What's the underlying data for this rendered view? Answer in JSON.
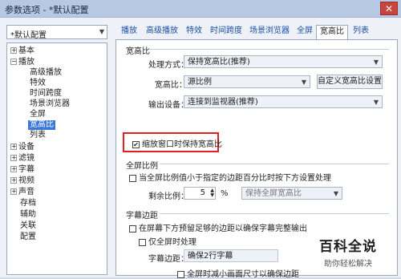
{
  "window": {
    "title": "参数选项 - *默认配置",
    "close_glyph": "✕"
  },
  "profile": {
    "value": "*默认配置"
  },
  "tree": [
    {
      "label": "基本",
      "expander": "+"
    },
    {
      "label": "播放",
      "expander": "−"
    },
    {
      "label": "高级播放"
    },
    {
      "label": "特效"
    },
    {
      "label": "时间跨度"
    },
    {
      "label": "场景浏览器"
    },
    {
      "label": "全屏"
    },
    {
      "label": "宽高比",
      "selected": true
    },
    {
      "label": "列表"
    },
    {
      "label": "设备",
      "expander": "+"
    },
    {
      "label": "滤镜",
      "expander": "+"
    },
    {
      "label": "字幕",
      "expander": "+"
    },
    {
      "label": "视频",
      "expander": "+"
    },
    {
      "label": "声音",
      "expander": "+"
    },
    {
      "label": "存档"
    },
    {
      "label": "辅助"
    },
    {
      "label": "关联"
    },
    {
      "label": "配置"
    }
  ],
  "tabs": [
    "播放",
    "高级播放",
    "特效",
    "时间跨度",
    "场景浏览器",
    "全屏",
    "宽高比",
    "列表"
  ],
  "aspect_group": {
    "title": "宽高比",
    "method_label": "处理方式：",
    "method_value": "保持宽高比(推荐)",
    "ratio_label": "宽高比：",
    "ratio_value": "源比例",
    "custom_button": "自定义宽高比设置",
    "output_label": "输出设备：",
    "output_value": "连接到监视器(推荐)",
    "keep_ratio_check": "缩放窗口时保持宽高比",
    "keep_ratio_checked": true
  },
  "fullscreen_group": {
    "title": "全屏比例",
    "condition_check": "当全屏比例值小于指定的边距百分比时按下方设置处理",
    "remain_label": "剩余比例：",
    "remain_value": "5",
    "percent": "%",
    "remain_mode": "保持全屏宽高比"
  },
  "subtitle_group": {
    "title": "字幕边距",
    "reserve_check": "在屏幕下方预留足够的边距以确保字幕完整输出",
    "fullscreen_only_check": "仅全屏时处理",
    "margin_label": "字幕边距：",
    "margin_value": "确保2行字幕",
    "reduce_check": "全屏时减小画面尺寸以确保边距"
  },
  "watermark": {
    "line1": "百科全说",
    "line2": "助你轻松解决"
  }
}
